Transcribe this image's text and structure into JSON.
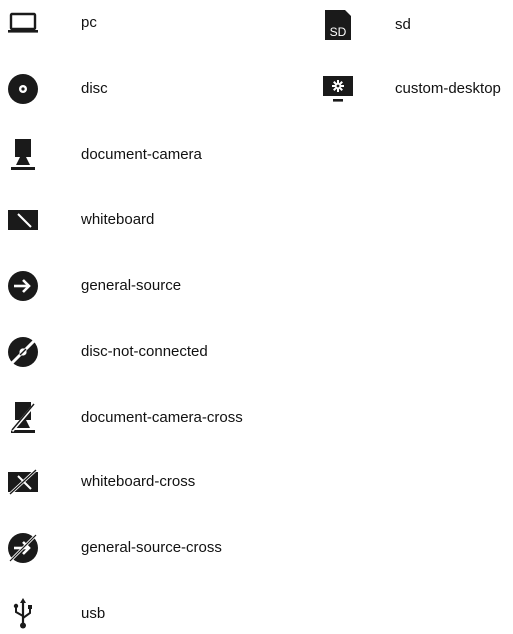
{
  "icons_left": [
    {
      "name": "pc-icon",
      "label": "pc"
    },
    {
      "name": "disc-icon",
      "label": "disc"
    },
    {
      "name": "document-camera-icon",
      "label": "document-camera"
    },
    {
      "name": "whiteboard-icon",
      "label": "whiteboard"
    },
    {
      "name": "general-source-icon",
      "label": "general-source"
    },
    {
      "name": "disc-not-connected-icon",
      "label": "disc-not-connected"
    },
    {
      "name": "document-camera-cross-icon",
      "label": "document-camera-cross"
    },
    {
      "name": "whiteboard-cross-icon",
      "label": "whiteboard-cross"
    },
    {
      "name": "general-source-cross-icon",
      "label": "general-source-cross"
    },
    {
      "name": "usb-icon",
      "label": "usb"
    }
  ],
  "icons_right": [
    {
      "name": "sd-icon",
      "label": "sd",
      "glyph_text": "SD"
    },
    {
      "name": "custom-desktop-icon",
      "label": "custom-desktop"
    }
  ],
  "colors": {
    "icon": "#1a1a1a",
    "text": "#111111",
    "background": "#ffffff"
  }
}
